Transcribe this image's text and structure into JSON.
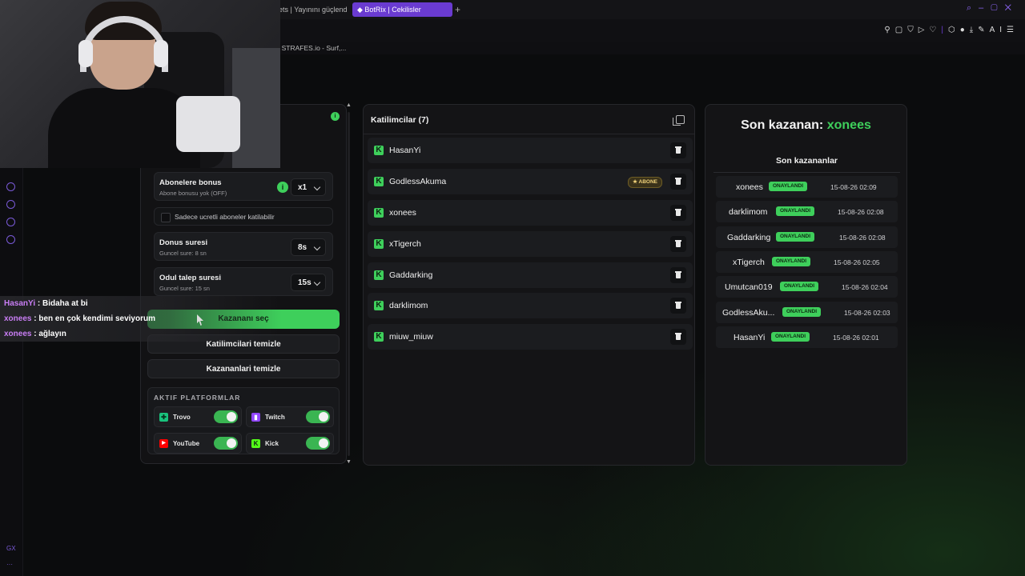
{
  "browser": {
    "tabs": [
      {
        "label": "gets | Yayınını güçlend"
      },
      {
        "label": "BotRix | Cekilisler",
        "active": true
      }
    ],
    "bookmark": "STRAFES.io - Surf,...",
    "toolbar_ai_label": "AI",
    "rail_bottom_label": "GX",
    "icons": [
      "pin-icon",
      "screenshot-icon",
      "shield-icon",
      "play-icon",
      "heart-icon",
      "extension-icon",
      "profile-icon",
      "download-icon",
      "ai-icon",
      "menu-icon"
    ]
  },
  "settings": {
    "abonelere_bonus": {
      "title": "Abonelere bonus",
      "subtitle": "Abone bonusu yok (OFF)",
      "value": "x1"
    },
    "sadece_ucretli": {
      "label": "Sadece ucretli aboneler katilabilir",
      "checked": false
    },
    "donus_suresi": {
      "title": "Donus suresi",
      "subtitle": "Guncel sure: 8 sn",
      "value": "8s"
    },
    "odul_talep": {
      "title": "Odul talep suresi",
      "subtitle": "Guncel sure: 15 sn",
      "value": "15s"
    },
    "info_glyph": "i"
  },
  "actions": {
    "pick_winner": "Kazananı seç",
    "clear_participants": "Katilimcilari temizle",
    "clear_winners": "Kazananlari temizle"
  },
  "platforms": {
    "title": "AKTIF PLATFORMLAR",
    "items": [
      {
        "name": "Trovo",
        "enabled": true,
        "color": "#19c37d"
      },
      {
        "name": "Twitch",
        "enabled": true,
        "color": "#9146ff"
      },
      {
        "name": "YouTube",
        "enabled": true,
        "color": "#ff0000"
      },
      {
        "name": "Kick",
        "enabled": true,
        "color": "#53fc18"
      }
    ]
  },
  "participants": {
    "title": "Katilimcilar (7)",
    "badge_label": "ABONE",
    "items": [
      "HasanYi",
      "GodlessAkuma",
      "xonees",
      "xTigerch",
      "Gaddarking",
      "darklimom",
      "miuw_miuw"
    ]
  },
  "winners": {
    "headline_prefix": "Son kazanan:",
    "headline_name": "xonees",
    "subtitle": "Son kazananlar",
    "status_label": "ONAYLANDI",
    "items": [
      {
        "name": "xonees",
        "time": "15-08-26 02:09"
      },
      {
        "name": "darklimom",
        "time": "15-08-26 02:08"
      },
      {
        "name": "Gaddarking",
        "time": "15-08-26 02:08"
      },
      {
        "name": "xTigerch",
        "time": "15-08-26 02:05"
      },
      {
        "name": "Umutcan019",
        "time": "15-08-26 02:04"
      },
      {
        "name": "GodlessAku...",
        "time": "15-08-26 02:03"
      },
      {
        "name": "HasanYi",
        "time": "15-08-26 02:01"
      }
    ]
  },
  "chat": [
    {
      "user": "HasanYi",
      "text": ": Bidaha at bi"
    },
    {
      "user": "xonees",
      "text": ": ben en çok kendimi seviyorum"
    },
    {
      "user": "xonees",
      "text": ": ağlayın"
    }
  ],
  "colors": {
    "accent": "#3ecf5b",
    "browser_accent": "#6a3bd1",
    "chat_user": "#c97ef5"
  }
}
